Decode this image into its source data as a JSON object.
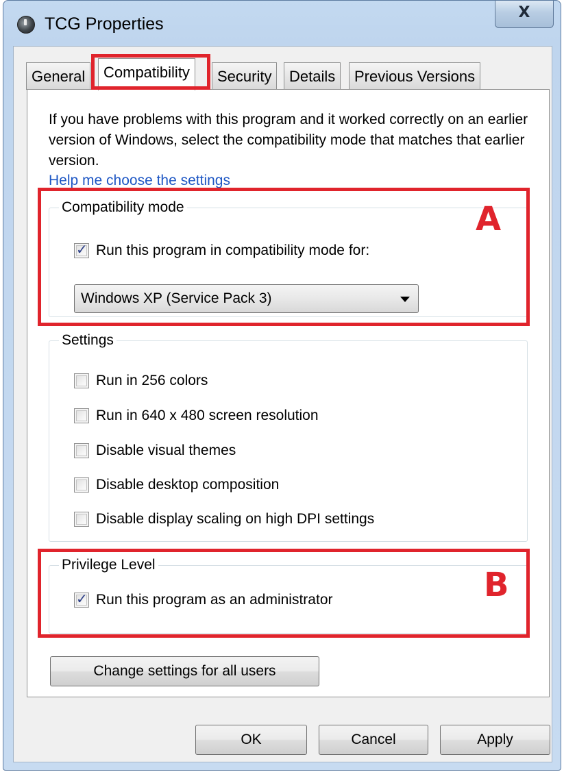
{
  "window": {
    "title": "TCG Properties",
    "close_label": "X"
  },
  "tabs": [
    {
      "label": "General",
      "active": false
    },
    {
      "label": "Compatibility",
      "active": true
    },
    {
      "label": "Security",
      "active": false
    },
    {
      "label": "Details",
      "active": false
    },
    {
      "label": "Previous Versions",
      "active": false
    }
  ],
  "panel": {
    "intro_text": "If you have problems with this program and it worked correctly on an earlier version of Windows, select the compatibility mode that matches that earlier version.",
    "help_link": "Help me choose the settings",
    "compat_group": {
      "label": "Compatibility mode",
      "checkbox_label": "Run this program in compatibility mode for:",
      "checked": true,
      "selected_mode": "Windows XP (Service Pack 3)"
    },
    "settings_group": {
      "label": "Settings",
      "items": [
        {
          "label": "Run in 256 colors",
          "checked": false
        },
        {
          "label": "Run in 640 x 480 screen resolution",
          "checked": false
        },
        {
          "label": "Disable visual themes",
          "checked": false
        },
        {
          "label": "Disable desktop composition",
          "checked": false
        },
        {
          "label": "Disable display scaling on high DPI settings",
          "checked": false
        }
      ]
    },
    "privilege_group": {
      "label": "Privilege Level",
      "checkbox_label": "Run this program as an administrator",
      "checked": true
    },
    "change_all_users_label": "Change settings for all users"
  },
  "footer": {
    "ok_label": "OK",
    "cancel_label": "Cancel",
    "apply_label": "Apply"
  },
  "annotations": {
    "box_a_letter": "A",
    "box_b_letter": "B",
    "color": "#e0242c"
  }
}
